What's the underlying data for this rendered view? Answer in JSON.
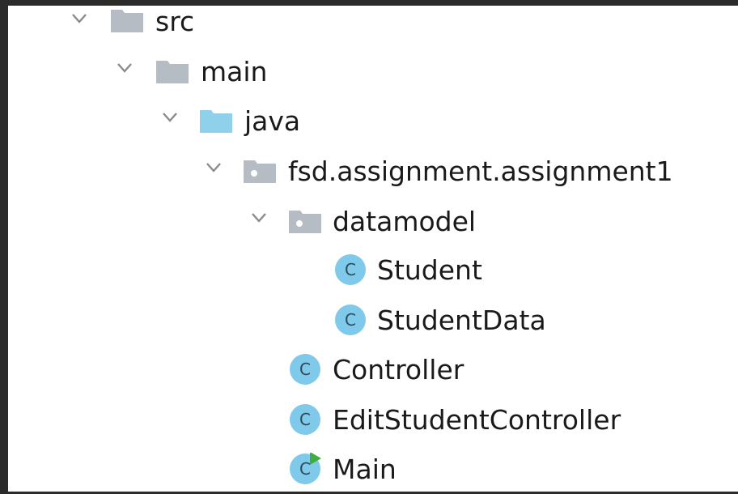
{
  "project_tree": {
    "nodes": [
      {
        "label": "src",
        "kind": "folder",
        "color": "#b5bcc4",
        "expanded": true
      },
      {
        "label": "main",
        "kind": "folder",
        "color": "#b5bcc4",
        "expanded": true
      },
      {
        "label": "java",
        "kind": "source-folder",
        "color": "#8fd0ea",
        "expanded": true
      },
      {
        "label": "fsd.assignment.assignment1",
        "kind": "package",
        "color": "#b5bcc4",
        "expanded": true
      },
      {
        "label": "datamodel",
        "kind": "package",
        "color": "#b5bcc4",
        "expanded": true
      },
      {
        "label": "Student",
        "kind": "class",
        "color": "#7fc9ea"
      },
      {
        "label": "StudentData",
        "kind": "class",
        "color": "#7fc9ea"
      },
      {
        "label": "Controller",
        "kind": "class",
        "color": "#7fc9ea"
      },
      {
        "label": "EditStudentController",
        "kind": "class",
        "color": "#7fc9ea"
      },
      {
        "label": "Main",
        "kind": "main-class",
        "color": "#7fc9ea",
        "run_marker_color": "#3fae3f"
      }
    ],
    "class_glyph": "C"
  }
}
